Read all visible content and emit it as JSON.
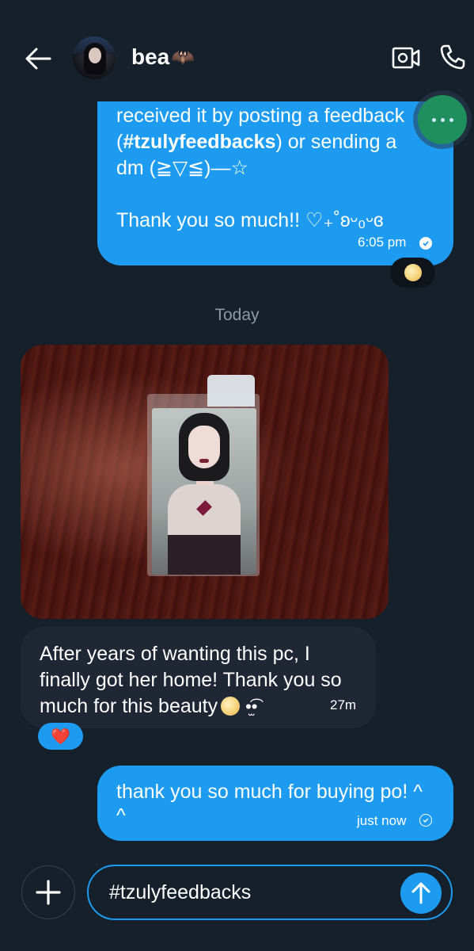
{
  "header": {
    "contact_name": "bea",
    "name_emoji": "🦇"
  },
  "messages": {
    "outgoing_1": {
      "text": "received it by posting a feedback\n(#tzulyfeedbacks) or sending a\ndm (≧▽≦)—☆\n\nThank you so much!! ♡₊˚ʚᵕ₀ᵕɞ",
      "hashtag": "#tzulyfeedbacks",
      "time": "6:05 pm",
      "reaction": "moon"
    },
    "date_separator": "Today",
    "incoming_1": {
      "text": "After years of wanting this pc, I finally got her home! Thank you so much for this beauty",
      "emoji_tail": "•̫͡•",
      "time": "27m",
      "reaction": "❤️"
    },
    "outgoing_2": {
      "text": "thank you so much for buying po! ^ ^",
      "time": "just now"
    }
  },
  "composer": {
    "value": "#tzulyfeedbacks"
  },
  "colors": {
    "background": "#15202b",
    "accent": "#1d9bf0",
    "incoming_bubble": "#1e2733"
  },
  "icons": [
    "back-arrow-icon",
    "video-call-icon",
    "phone-icon",
    "more-icon",
    "plus-icon",
    "send-arrow-icon",
    "read-check-icon",
    "sent-check-icon"
  ]
}
